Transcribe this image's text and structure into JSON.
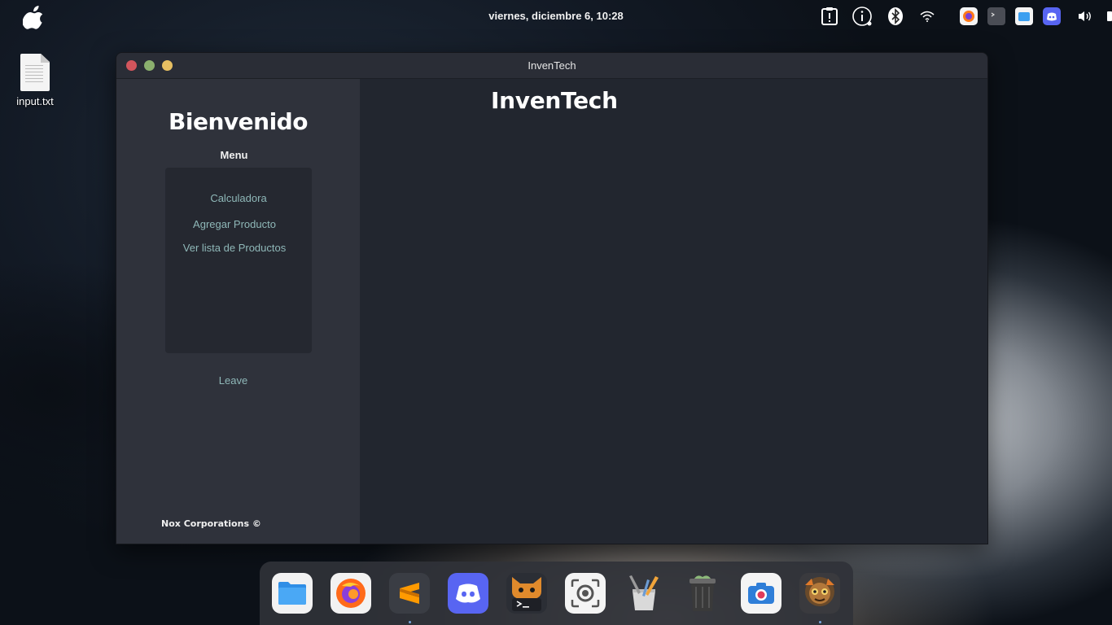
{
  "topbar": {
    "clock": "viernes, diciembre  6, 10:28"
  },
  "desktop": {
    "file_label": "input.txt"
  },
  "window": {
    "title": "InvenTech",
    "sidebar": {
      "welcome": "Bienvenido",
      "menu_label": "Menu",
      "items": [
        {
          "label": "Calculadora"
        },
        {
          "label": "Agregar Producto"
        },
        {
          "label": "Ver lista de Productos"
        }
      ],
      "leave": "Leave",
      "footer": "Nox Corporations ©"
    },
    "main": {
      "title": "InvenTech"
    }
  },
  "dock": {
    "apps": [
      "files-icon",
      "firefox-icon",
      "sublime-text-icon",
      "discord-icon",
      "terminal-icon",
      "screenshot-icon",
      "text-editor-icon",
      "trash-icon",
      "camera-icon",
      "avatar-app-icon"
    ]
  },
  "colors": {
    "sidebar_bg": "#2f323b",
    "content_bg": "#22262f",
    "menu_box_bg": "#252830",
    "link_color": "#8fb8b8",
    "close": "#d2555c",
    "minimize": "#8bb06e",
    "maximize": "#e7bf62"
  }
}
